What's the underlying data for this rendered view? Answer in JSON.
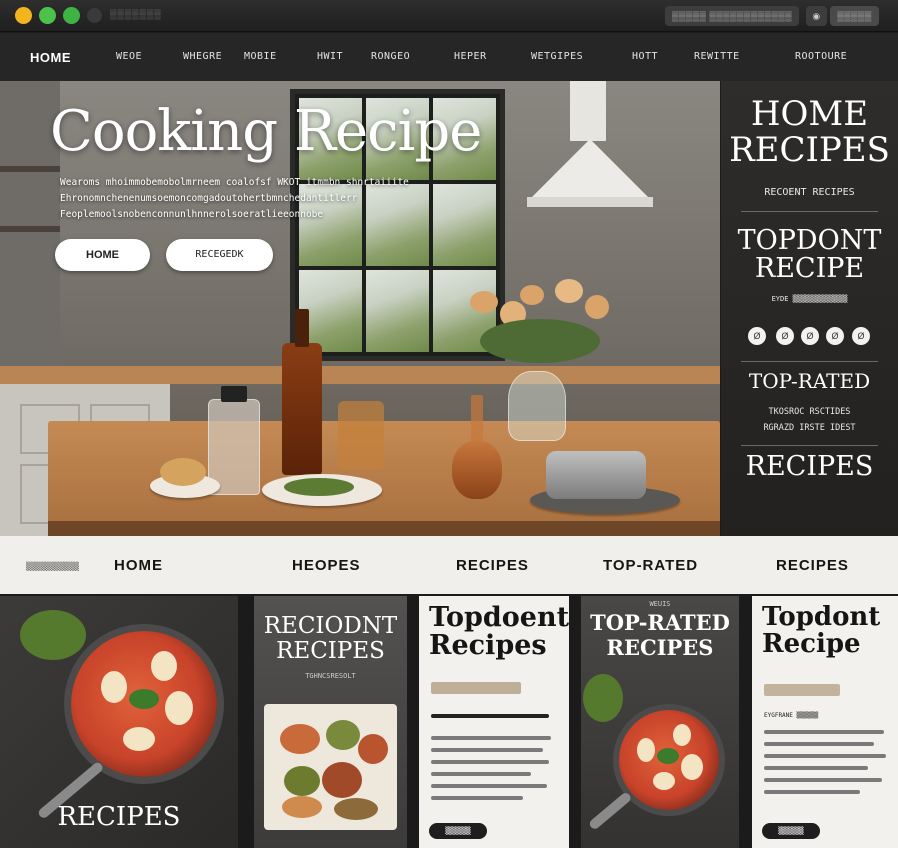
{
  "window": {
    "title": "▒▒▒▒▒▒▒",
    "toolbar_left": "▒▒▒▒▒ ▒▒▒▒▒▒▒▒▒▒▒▒",
    "toolbar_mid": "◉",
    "toolbar_right": "▒▒▒▒▒"
  },
  "top_nav": {
    "items": [
      "HOME",
      "WEOE",
      "WHEGRE",
      "MOBIE",
      "HWIT",
      "RONGEO",
      "HEPER",
      "WETGIPES",
      "HOTT",
      "REWITTE",
      "ROOTOURE"
    ]
  },
  "hero": {
    "title": "Cooking Recipe",
    "subtitle": "Wearoms mhoimmobemobolmrneem coalofsf WKOT itmmbn shnrtaiiite Ehronomnchenenumsoemoncomgadoutohertbmnchedantitlerr Feoplemoolsnobenconnunlhnnerolsoeratlieeonnobe",
    "buttons": [
      "HOME",
      "RECEGEDK"
    ],
    "accent": "#ffffff"
  },
  "sidebar": {
    "heading1": "HOME\nRECIPES",
    "sub1": "RECOENT RECIPES",
    "heading2": "TOPDONT\nRECIPE",
    "sub2": "EYDE ▒▒▒▒▒▒▒▒▒▒▒▒▒",
    "circles": [
      "Ø",
      "Ø",
      "Ø",
      "Ø",
      "Ø"
    ],
    "heading3": "TOP-RATED",
    "sub3": "TKOSROC RSCTIDES",
    "sub3b": "RGRAZD IRSTE IDEST",
    "heading4": "RECIPES"
  },
  "sub_nav": {
    "tiny": "▒▒▒▒▒▒▒▒▒▒▒",
    "items": [
      "HOME",
      "HEOPES",
      "RECIPES",
      "TOP-RATED",
      "RECIPES"
    ]
  },
  "cards": [
    {
      "title": "RECIPES"
    },
    {
      "title": "RECIODNT\nRECIPES",
      "caption": "TGHNCSRESOLT"
    },
    {
      "title": "Topdoent\nRecipes",
      "line1": "▒▒▒▒▒▒▒▒▒▒",
      "line2": "▒▒▒▒▒▒▒▒▒▒▒▒▒▒",
      "button": "▒▒▒▒▒▒"
    },
    {
      "kicker": "WEUIS",
      "title": "TOP-RATED\nRECIPES"
    },
    {
      "title": "Topdont\nRecipe",
      "line1": "▒▒▒▒▒▒▒▒",
      "line2": "EYGFRANE ▒▒▒▒▒▒",
      "button": "▒▒▒▒▒▒"
    }
  ],
  "colors": {
    "nav_bg": "#262626",
    "sidebar_bg": "#2f2d2b",
    "subnav_bg": "#f1efec",
    "traffic_yellow": "#f3b51e",
    "traffic_green": "#4cc24a"
  }
}
